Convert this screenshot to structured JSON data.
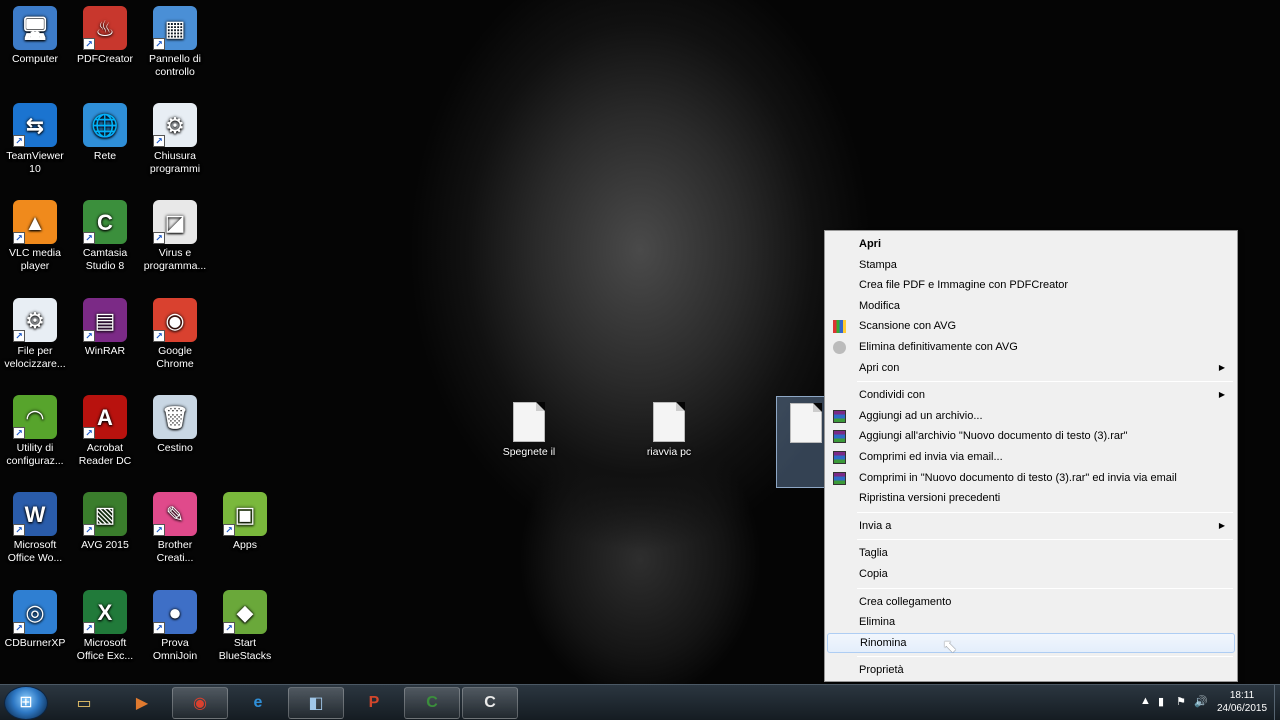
{
  "desktop_icons": [
    {
      "label": "Computer",
      "icon": "computer-icon",
      "glyph": "🖥"
    },
    {
      "label": "PDFCreator",
      "icon": "pdfcreator-icon",
      "glyph": "♨"
    },
    {
      "label": "Pannello di controllo",
      "icon": "control-panel-icon",
      "glyph": "▦"
    },
    {
      "label": "TeamViewer 10",
      "icon": "teamviewer-icon",
      "glyph": "⇆"
    },
    {
      "label": "Rete",
      "icon": "network-icon",
      "glyph": "🌐"
    },
    {
      "label": "Chiusura programmi",
      "icon": "program-shutdown-icon",
      "glyph": "⚙"
    },
    {
      "label": "VLC media player",
      "icon": "vlc-icon",
      "glyph": "▲"
    },
    {
      "label": "Camtasia Studio 8",
      "icon": "camtasia-icon",
      "glyph": "C"
    },
    {
      "label": "Virus e programma...",
      "icon": "virus-program-icon",
      "glyph": "◪"
    },
    {
      "label": "File per velocizzare...",
      "icon": "file-speed-icon",
      "glyph": "⚙"
    },
    {
      "label": "WinRAR",
      "icon": "winrar-icon",
      "glyph": "▤"
    },
    {
      "label": "Google Chrome",
      "icon": "chrome-icon",
      "glyph": "◉"
    },
    {
      "label": "Utility di configuraz...",
      "icon": "config-utility-icon",
      "glyph": "◠"
    },
    {
      "label": "Acrobat Reader DC",
      "icon": "acrobat-icon",
      "glyph": "A"
    },
    {
      "label": "Cestino",
      "icon": "recycle-bin-icon",
      "glyph": "🗑"
    },
    {
      "label": "Microsoft Office Wo...",
      "icon": "word-icon",
      "glyph": "W"
    },
    {
      "label": "AVG 2015",
      "icon": "avg-icon",
      "glyph": "▧"
    },
    {
      "label": "Brother Creati...",
      "icon": "brother-icon",
      "glyph": "✎"
    },
    {
      "label": "Apps",
      "icon": "apps-icon",
      "glyph": "▣"
    },
    {
      "label": "CDBurnerXP",
      "icon": "cdburner-icon",
      "glyph": "◎"
    },
    {
      "label": "Microsoft Office Exc...",
      "icon": "excel-icon",
      "glyph": "X"
    },
    {
      "label": "Prova OmniJoin",
      "icon": "omnijoin-icon",
      "glyph": "●"
    },
    {
      "label": "Start BlueStacks",
      "icon": "bluestacks-icon",
      "glyph": "◆"
    }
  ],
  "files": [
    {
      "label": "Spegnete il"
    },
    {
      "label": "riavvia pc"
    }
  ],
  "context_menu": {
    "items": [
      {
        "label": "Apri",
        "bold": true
      },
      {
        "label": "Stampa"
      },
      {
        "label": "Crea file PDF e Immagine con PDFCreator"
      },
      {
        "label": "Modifica"
      },
      {
        "label": "Scansione con AVG",
        "icon": "avg-scan-icon"
      },
      {
        "label": "Elimina definitivamente con AVG",
        "icon": "avg-shred-icon"
      },
      {
        "label": "Apri con",
        "submenu": true
      },
      {
        "sep": true
      },
      {
        "label": "Condividi con",
        "submenu": true
      },
      {
        "label": "Aggiungi ad un archivio...",
        "icon": "rar"
      },
      {
        "label": "Aggiungi all'archivio \"Nuovo documento di testo (3).rar\"",
        "icon": "rar"
      },
      {
        "label": "Comprimi ed invia via email...",
        "icon": "rar"
      },
      {
        "label": "Comprimi in \"Nuovo documento di testo (3).rar\" ed invia via email",
        "icon": "rar"
      },
      {
        "label": "Ripristina versioni precedenti"
      },
      {
        "sep": true
      },
      {
        "label": "Invia a",
        "submenu": true
      },
      {
        "sep": true
      },
      {
        "label": "Taglia"
      },
      {
        "label": "Copia"
      },
      {
        "sep": true
      },
      {
        "label": "Crea collegamento"
      },
      {
        "label": "Elimina"
      },
      {
        "label": "Rinomina",
        "hover": true
      },
      {
        "sep": true
      },
      {
        "label": "Proprietà"
      }
    ]
  },
  "taskbar": {
    "buttons": [
      {
        "icon": "explorer-icon",
        "glyph": "▭",
        "open": false
      },
      {
        "icon": "media-player-icon",
        "glyph": "▶",
        "open": false
      },
      {
        "icon": "chrome-taskbar-icon",
        "glyph": "◉",
        "open": true
      },
      {
        "icon": "ie-icon",
        "glyph": "e",
        "open": false
      },
      {
        "icon": "window-icon",
        "glyph": "◧",
        "open": true
      },
      {
        "icon": "powerpoint-icon",
        "glyph": "P",
        "open": false
      },
      {
        "icon": "camtasia-taskbar-icon",
        "glyph": "C",
        "open": true
      },
      {
        "icon": "camtasia-recorder-icon",
        "glyph": "C",
        "open": true
      }
    ],
    "time": "18:11",
    "date": "24/06/2015"
  }
}
